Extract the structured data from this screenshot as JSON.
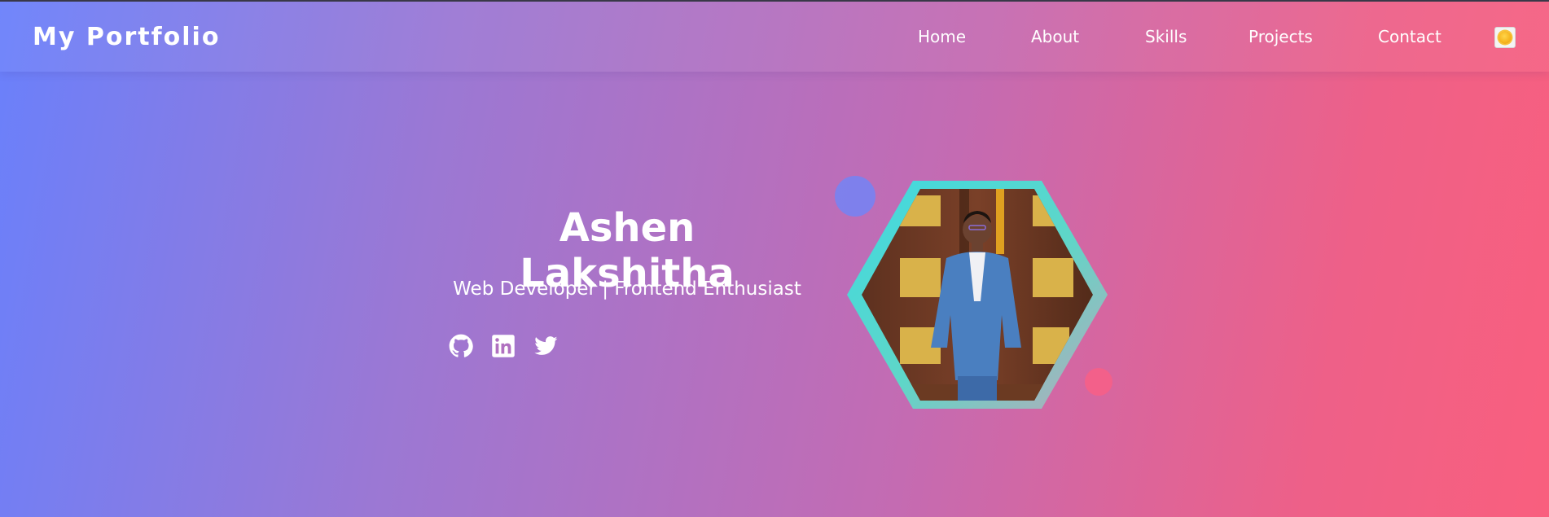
{
  "navbar": {
    "logo": "My Portfolio",
    "links": [
      {
        "label": "Home"
      },
      {
        "label": "About"
      },
      {
        "label": "Skills"
      },
      {
        "label": "Projects"
      },
      {
        "label": "Contact"
      }
    ],
    "theme_toggle_icon": "sun-icon"
  },
  "hero": {
    "name": "Ashen Lakshitha",
    "tagline": "Web Developer | Frontend Enthusiast",
    "socials": [
      {
        "icon": "github-icon"
      },
      {
        "icon": "linkedin-icon"
      },
      {
        "icon": "twitter-icon"
      }
    ],
    "profile_photo": "profile-photo"
  },
  "colors": {
    "gradient_start": "#6a80fb",
    "gradient_end": "#f95f7e",
    "hex_border_start": "#3fd9e0",
    "hex_border_end": "#b8a9b8",
    "accent_blue_circle": "#7a82ee",
    "accent_pink_circle": "#f3608a"
  }
}
